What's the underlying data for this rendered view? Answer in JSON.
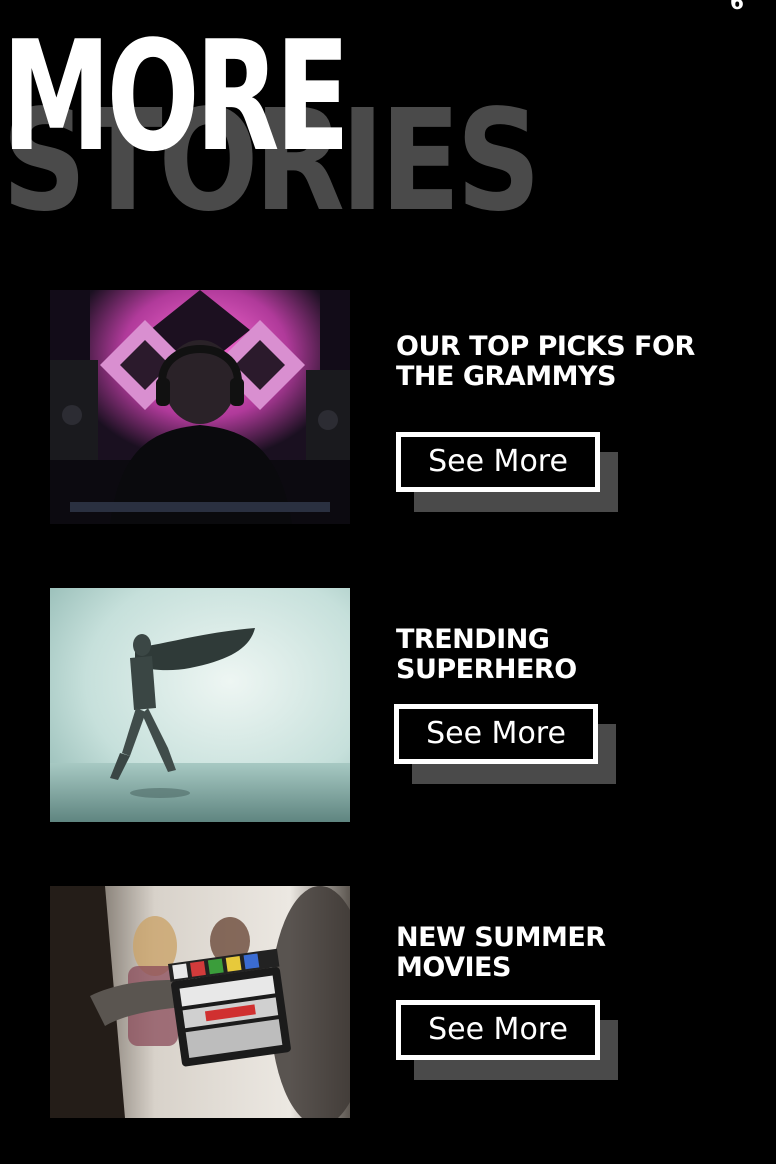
{
  "heading": {
    "line1": "MORE",
    "line2": "STORIES"
  },
  "corner_glyph": "6",
  "stories": [
    {
      "title_line1": "OUR TOP PICKS FOR",
      "title_line2": "THE GRAMMYS",
      "button_label": "See More",
      "image": "music-producer-headphones-studio-photo"
    },
    {
      "title_line1": "TRENDING",
      "title_line2": "SUPERHERO",
      "button_label": "See More",
      "image": "caped-figure-in-mist-photo"
    },
    {
      "title_line1": "NEW SUMMER",
      "title_line2": "MOVIES",
      "button_label": "See More",
      "image": "film-clapperboard-on-set-photo"
    }
  ],
  "colors": {
    "background": "#000000",
    "text": "#ffffff",
    "heading_back": "#4a4a4a",
    "button_shadow": "#4a4a4a"
  }
}
